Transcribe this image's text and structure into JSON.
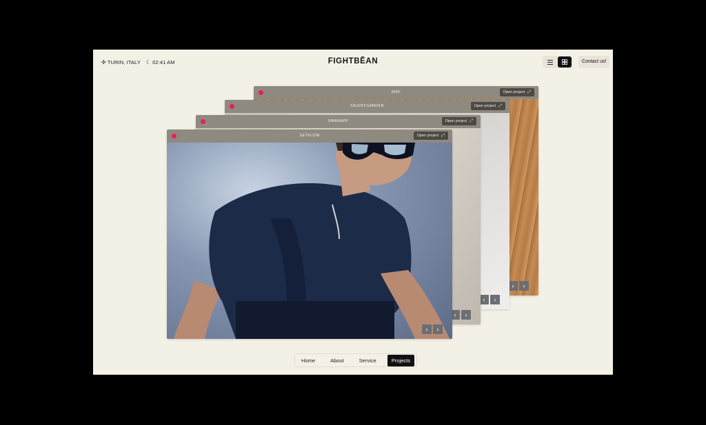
{
  "header": {
    "location": "TURIN, ITALY",
    "time": "02:41 AM",
    "brand": "FIGHTBĒAN",
    "contact_label": "Contact us!"
  },
  "cards": [
    {
      "title": "MSF",
      "open_label": "Open project"
    },
    {
      "title": "TALENTGARDEN",
      "open_label": "Open project"
    },
    {
      "title": "SMANAPP",
      "open_label": "Open project"
    },
    {
      "title": "SETFLOW",
      "open_label": "Open project"
    }
  ],
  "icons": {
    "location": "location-icon",
    "moon": "moon-icon",
    "list": "list-icon",
    "grid": "grid-icon",
    "expand": "expand-icon",
    "prev": "chevron-left-icon",
    "next": "chevron-right-icon"
  },
  "colors": {
    "accent_dot": "#ea1d5d",
    "background": "#f3f0e6",
    "active_nav": "#111111"
  },
  "nav": {
    "items": [
      "Home",
      "About",
      "Service",
      "Projects"
    ],
    "active": "Projects"
  }
}
